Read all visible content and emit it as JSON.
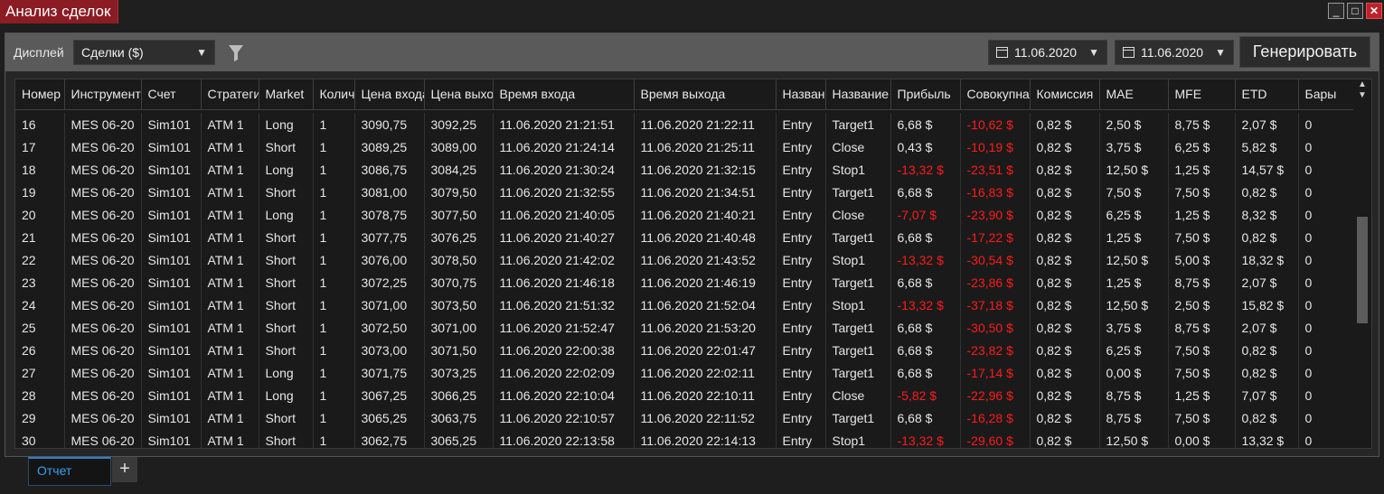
{
  "window": {
    "title": "Анализ сделок",
    "controls": [
      "_",
      "□",
      "✕"
    ]
  },
  "toolbar": {
    "display_label": "Дисплей",
    "display_value": "Сделки ($)",
    "date_from": "11.06.2020",
    "date_to": "11.06.2020",
    "generate_label": "Генерировать"
  },
  "table": {
    "columns": [
      "Номер",
      "Инструмент",
      "Счет",
      "Стратегия",
      "Market",
      "Количество",
      "Цена входа",
      "Цена выхода",
      "Время входа",
      "Время выхода",
      "Название",
      "Название",
      "Прибыль",
      "Совокупная",
      "Комиссия",
      "MAE",
      "MFE",
      "ETD",
      "Бары"
    ],
    "rows": [
      [
        "16",
        "MES 06-20",
        "Sim101",
        "ATM 1",
        "Long",
        "1",
        "3090,75",
        "3092,25",
        "11.06.2020 21:21:51",
        "11.06.2020 21:22:11",
        "Entry",
        "Target1",
        "6,68 $",
        "-10,62 $",
        "0,82 $",
        "2,50 $",
        "8,75 $",
        "2,07 $",
        "0"
      ],
      [
        "17",
        "MES 06-20",
        "Sim101",
        "ATM 1",
        "Short",
        "1",
        "3089,25",
        "3089,00",
        "11.06.2020 21:24:14",
        "11.06.2020 21:25:11",
        "Entry",
        "Close",
        "0,43 $",
        "-10,19 $",
        "0,82 $",
        "3,75 $",
        "6,25 $",
        "5,82 $",
        "0"
      ],
      [
        "18",
        "MES 06-20",
        "Sim101",
        "ATM 1",
        "Long",
        "1",
        "3086,75",
        "3084,25",
        "11.06.2020 21:30:24",
        "11.06.2020 21:32:15",
        "Entry",
        "Stop1",
        "-13,32 $",
        "-23,51 $",
        "0,82 $",
        "12,50 $",
        "1,25 $",
        "14,57 $",
        "0"
      ],
      [
        "19",
        "MES 06-20",
        "Sim101",
        "ATM 1",
        "Short",
        "1",
        "3081,00",
        "3079,50",
        "11.06.2020 21:32:55",
        "11.06.2020 21:34:51",
        "Entry",
        "Target1",
        "6,68 $",
        "-16,83 $",
        "0,82 $",
        "7,50 $",
        "7,50 $",
        "0,82 $",
        "0"
      ],
      [
        "20",
        "MES 06-20",
        "Sim101",
        "ATM 1",
        "Long",
        "1",
        "3078,75",
        "3077,50",
        "11.06.2020 21:40:05",
        "11.06.2020 21:40:21",
        "Entry",
        "Close",
        "-7,07 $",
        "-23,90 $",
        "0,82 $",
        "6,25 $",
        "1,25 $",
        "8,32 $",
        "0"
      ],
      [
        "21",
        "MES 06-20",
        "Sim101",
        "ATM 1",
        "Short",
        "1",
        "3077,75",
        "3076,25",
        "11.06.2020 21:40:27",
        "11.06.2020 21:40:48",
        "Entry",
        "Target1",
        "6,68 $",
        "-17,22 $",
        "0,82 $",
        "1,25 $",
        "7,50 $",
        "0,82 $",
        "0"
      ],
      [
        "22",
        "MES 06-20",
        "Sim101",
        "ATM 1",
        "Short",
        "1",
        "3076,00",
        "3078,50",
        "11.06.2020 21:42:02",
        "11.06.2020 21:43:52",
        "Entry",
        "Stop1",
        "-13,32 $",
        "-30,54 $",
        "0,82 $",
        "12,50 $",
        "5,00 $",
        "18,32 $",
        "0"
      ],
      [
        "23",
        "MES 06-20",
        "Sim101",
        "ATM 1",
        "Short",
        "1",
        "3072,25",
        "3070,75",
        "11.06.2020 21:46:18",
        "11.06.2020 21:46:19",
        "Entry",
        "Target1",
        "6,68 $",
        "-23,86 $",
        "0,82 $",
        "1,25 $",
        "8,75 $",
        "2,07 $",
        "0"
      ],
      [
        "24",
        "MES 06-20",
        "Sim101",
        "ATM 1",
        "Short",
        "1",
        "3071,00",
        "3073,50",
        "11.06.2020 21:51:32",
        "11.06.2020 21:52:04",
        "Entry",
        "Stop1",
        "-13,32 $",
        "-37,18 $",
        "0,82 $",
        "12,50 $",
        "2,50 $",
        "15,82 $",
        "0"
      ],
      [
        "25",
        "MES 06-20",
        "Sim101",
        "ATM 1",
        "Short",
        "1",
        "3072,50",
        "3071,00",
        "11.06.2020 21:52:47",
        "11.06.2020 21:53:20",
        "Entry",
        "Target1",
        "6,68 $",
        "-30,50 $",
        "0,82 $",
        "3,75 $",
        "8,75 $",
        "2,07 $",
        "0"
      ],
      [
        "26",
        "MES 06-20",
        "Sim101",
        "ATM 1",
        "Short",
        "1",
        "3073,00",
        "3071,50",
        "11.06.2020 22:00:38",
        "11.06.2020 22:01:47",
        "Entry",
        "Target1",
        "6,68 $",
        "-23,82 $",
        "0,82 $",
        "6,25 $",
        "7,50 $",
        "0,82 $",
        "0"
      ],
      [
        "27",
        "MES 06-20",
        "Sim101",
        "ATM 1",
        "Long",
        "1",
        "3071,75",
        "3073,25",
        "11.06.2020 22:02:09",
        "11.06.2020 22:02:11",
        "Entry",
        "Target1",
        "6,68 $",
        "-17,14 $",
        "0,82 $",
        "0,00 $",
        "7,50 $",
        "0,82 $",
        "0"
      ],
      [
        "28",
        "MES 06-20",
        "Sim101",
        "ATM 1",
        "Long",
        "1",
        "3067,25",
        "3066,25",
        "11.06.2020 22:10:04",
        "11.06.2020 22:10:11",
        "Entry",
        "Close",
        "-5,82 $",
        "-22,96 $",
        "0,82 $",
        "8,75 $",
        "1,25 $",
        "7,07 $",
        "0"
      ],
      [
        "29",
        "MES 06-20",
        "Sim101",
        "ATM 1",
        "Short",
        "1",
        "3065,25",
        "3063,75",
        "11.06.2020 22:10:57",
        "11.06.2020 22:11:52",
        "Entry",
        "Target1",
        "6,68 $",
        "-16,28 $",
        "0,82 $",
        "8,75 $",
        "7,50 $",
        "0,82 $",
        "0"
      ],
      [
        "30",
        "MES 06-20",
        "Sim101",
        "ATM 1",
        "Short",
        "1",
        "3062,75",
        "3065,25",
        "11.06.2020 22:13:58",
        "11.06.2020 22:14:13",
        "Entry",
        "Stop1",
        "-13,32 $",
        "-29,60 $",
        "0,82 $",
        "12,50 $",
        "0,00 $",
        "13,32 $",
        "0"
      ]
    ]
  },
  "tabs": {
    "active": "Отчет",
    "add": "+"
  },
  "colors": {
    "title_bg": "#8b1c24",
    "negative": "#ff1a1a",
    "tab_accent": "#2a82d0"
  }
}
